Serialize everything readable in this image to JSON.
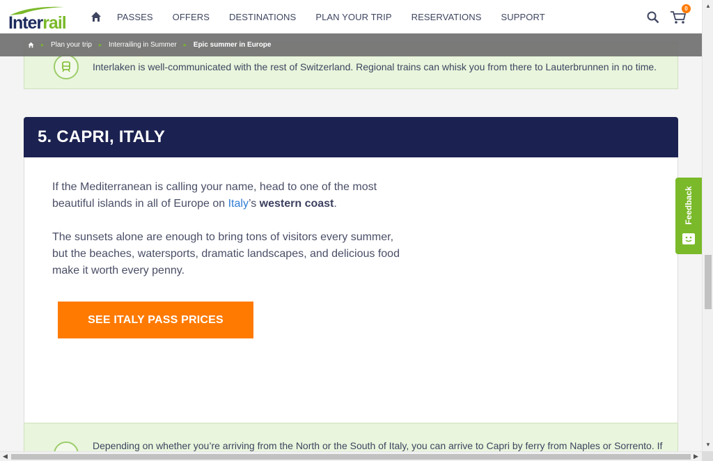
{
  "header": {
    "logo_inter": "Inter",
    "logo_rail": "rail",
    "nav": [
      "PASSES",
      "OFFERS",
      "DESTINATIONS",
      "PLAN YOUR TRIP",
      "RESERVATIONS",
      "SUPPORT"
    ],
    "cart_count": "0"
  },
  "breadcrumb": {
    "items": [
      "Plan your trip",
      "Interrailing in Summer"
    ],
    "current": "Epic summer in Europe"
  },
  "info_top": {
    "text": "Interlaken is well-communicated with the rest of Switzerland. Regional trains can whisk you from there to Lauterbrunnen in no time."
  },
  "section": {
    "title": "5. CAPRI, ITALY",
    "p1_before": "If the Mediterranean is calling your name, head to one of the most beautiful islands in all of Europe on ",
    "p1_link": "Italy",
    "p1_mid": "’s ",
    "p1_bold": "western coast",
    "p1_end": ".",
    "p2": "The sunsets alone are enough to bring tons of visitors every summer, but the beaches, watersports, dramatic landscapes, and delicious food make it worth every penny.",
    "cta": "SEE ITALY PASS PRICES"
  },
  "info_bottom": {
    "text": "Depending on whether you’re arriving from the North or the South of Italy, you can arrive to Capri by ferry from Naples or Sorrento. If"
  },
  "feedback": {
    "label": "Feedback"
  },
  "colors": {
    "brand_green": "#7ab929",
    "navy": "#1b2150",
    "cta_orange": "#ff7a00"
  }
}
